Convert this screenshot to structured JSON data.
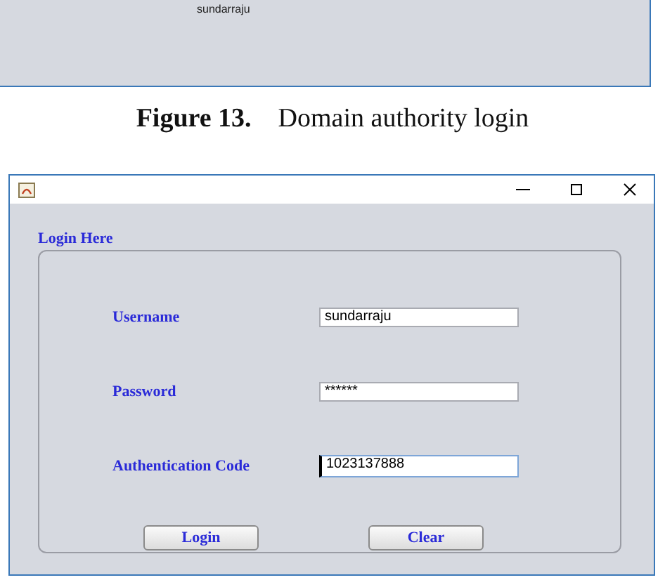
{
  "previous_figure": {
    "value": "sundarraju"
  },
  "caption": {
    "label": "Figure 13.",
    "text": "Domain authority login"
  },
  "window": {
    "group_title": "Login Here",
    "fields": [
      {
        "label": "Username",
        "value": "sundarraju",
        "focused": false
      },
      {
        "label": "Password",
        "value": "******",
        "focused": false
      },
      {
        "label": "Authentication Code",
        "value": "1023137888",
        "focused": true
      }
    ],
    "buttons": [
      "Login",
      "Clear"
    ]
  }
}
